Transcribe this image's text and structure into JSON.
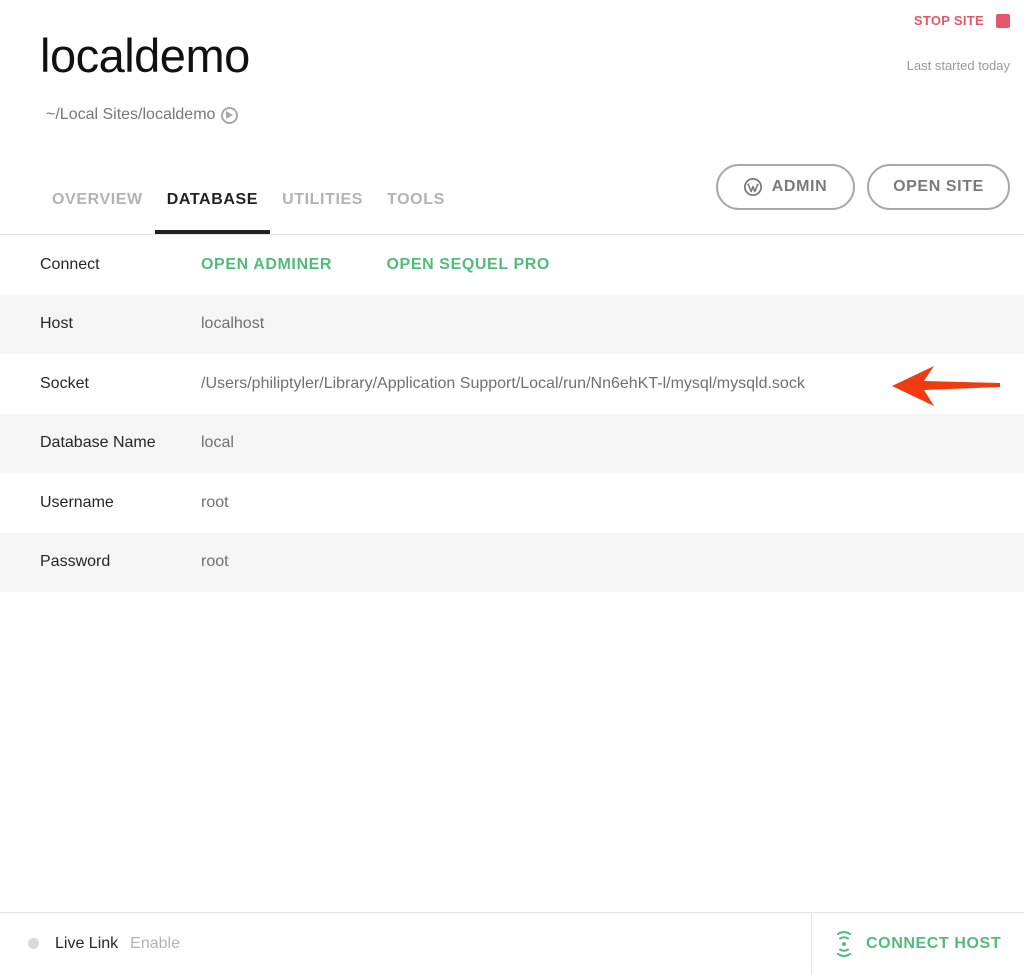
{
  "site": {
    "title": "localdemo",
    "path": "~/Local Sites/localdemo",
    "stop_label": "STOP SITE",
    "last_started": "Last started today"
  },
  "header_buttons": {
    "admin": "ADMIN",
    "open_site": "OPEN SITE"
  },
  "tabs": [
    {
      "label": "OVERVIEW",
      "active": false
    },
    {
      "label": "DATABASE",
      "active": true
    },
    {
      "label": "UTILITIES",
      "active": false
    },
    {
      "label": "TOOLS",
      "active": false
    }
  ],
  "database": {
    "connect": {
      "label": "Connect",
      "links": [
        "OPEN ADMINER",
        "OPEN SEQUEL PRO"
      ]
    },
    "rows": [
      {
        "label": "Host",
        "value": "localhost"
      },
      {
        "label": "Socket",
        "value": "/Users/philiptyler/Library/Application Support/Local/run/Nn6ehKT-l/mysql/mysqld.sock"
      },
      {
        "label": "Database Name",
        "value": "local"
      },
      {
        "label": "Username",
        "value": "root"
      },
      {
        "label": "Password",
        "value": "root"
      }
    ]
  },
  "footer": {
    "live_link_label": "Live Link",
    "enable_label": "Enable",
    "connect_host_label": "CONNECT HOST"
  },
  "colors": {
    "accent_green": "#51bb7b",
    "stop_red": "#e5566b",
    "annotation_arrow": "#f03a12"
  },
  "icons": {
    "path_reveal": "arrow-circle-icon",
    "admin": "wordpress-icon",
    "stop": "stop-square-icon",
    "live_link": "status-dot-icon",
    "connect_host": "signal-icon",
    "annotation": "red-arrow-icon"
  }
}
